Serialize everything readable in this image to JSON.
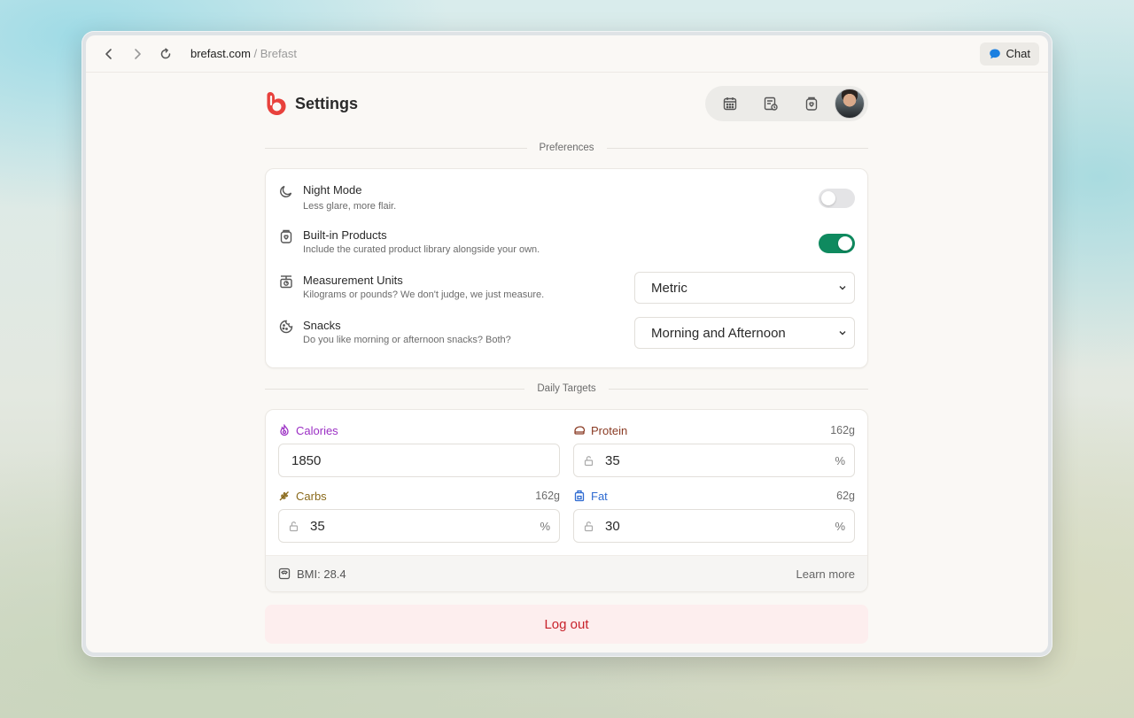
{
  "browser": {
    "domain": "brefast.com",
    "separator": " / ",
    "page": "Brefast",
    "chat_label": "Chat"
  },
  "header": {
    "title": "Settings"
  },
  "sections": {
    "preferences": "Preferences",
    "daily_targets": "Daily Targets"
  },
  "preferences": {
    "night_mode": {
      "title": "Night Mode",
      "desc": "Less glare, more flair.",
      "enabled": false
    },
    "built_in_products": {
      "title": "Built-in Products",
      "desc": "Include the curated product library alongside your own.",
      "enabled": true
    },
    "measurement_units": {
      "title": "Measurement Units",
      "desc": "Kilograms or pounds? We don't judge, we just measure.",
      "value": "Metric"
    },
    "snacks": {
      "title": "Snacks",
      "desc": "Do you like morning or afternoon snacks? Both?",
      "value": "Morning and Afternoon"
    }
  },
  "targets": {
    "calories": {
      "label": "Calories",
      "value": "1850",
      "color": "#9b2fc4"
    },
    "protein": {
      "label": "Protein",
      "grams": "162g",
      "value": "35",
      "unit": "%",
      "color": "#8a3b24"
    },
    "carbs": {
      "label": "Carbs",
      "grams": "162g",
      "value": "35",
      "unit": "%",
      "color": "#8a6a1c"
    },
    "fat": {
      "label": "Fat",
      "grams": "62g",
      "value": "30",
      "unit": "%",
      "color": "#2f6bd1"
    }
  },
  "bmi": {
    "text": "BMI: 28.4",
    "learn_more": "Learn more"
  },
  "logout_label": "Log out",
  "colors": {
    "accent": "#e8413c",
    "toggle_on": "#0f8a5f",
    "logout_text": "#c8222b",
    "logout_bg": "#fdeeee"
  }
}
